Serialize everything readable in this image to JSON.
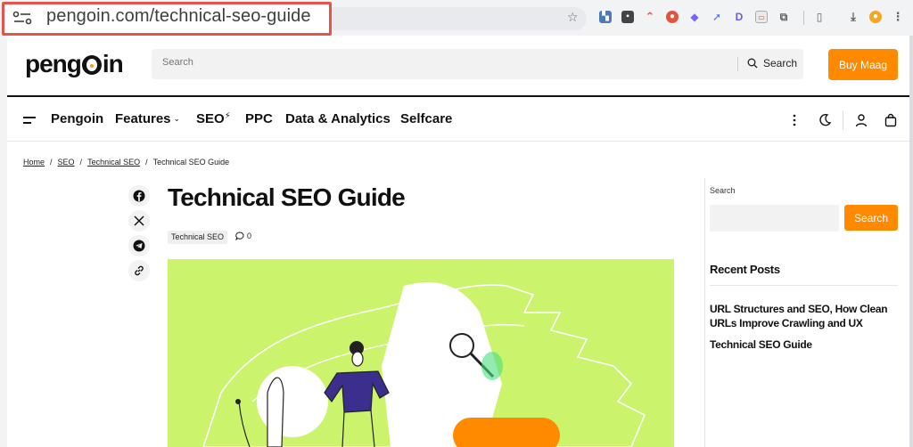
{
  "browser": {
    "url": "pengoin.com/technical-seo-guide",
    "extensions": [
      "chart-icon",
      "square-icon",
      "caret-icon",
      "cookie-icon",
      "tag-icon",
      "rocket-icon",
      "d-icon",
      "cast-icon",
      "puzzle-icon",
      "reader-icon",
      "download-icon",
      "profile-icon",
      "menu-icon"
    ]
  },
  "header": {
    "logo": "pengoin",
    "search_placeholder": "Search",
    "search_button": "Search",
    "buy_button": "Buy Maag"
  },
  "nav": {
    "items": [
      {
        "label": "Pengoin"
      },
      {
        "label": "Features"
      },
      {
        "label": "SEO"
      },
      {
        "label": "PPC"
      },
      {
        "label": "Data & Analytics"
      },
      {
        "label": "Selfcare"
      }
    ]
  },
  "breadcrumb": {
    "home": "Home",
    "seo": "SEO",
    "technical_seo": "Technical SEO",
    "current": "Technical SEO Guide",
    "separator": "/"
  },
  "article": {
    "title": "Technical SEO Guide",
    "tag": "Technical SEO",
    "comment_count": "0"
  },
  "sidebar": {
    "search_label": "Search",
    "search_button": "Search",
    "recent_heading": "Recent Posts",
    "posts": [
      "URL Structures and SEO, How Clean URLs Improve Crawling and UX",
      "Technical SEO Guide"
    ]
  },
  "colors": {
    "accent": "#ff8a00",
    "hero_bg": "#cbf36b",
    "highlight": "#e5534b"
  }
}
